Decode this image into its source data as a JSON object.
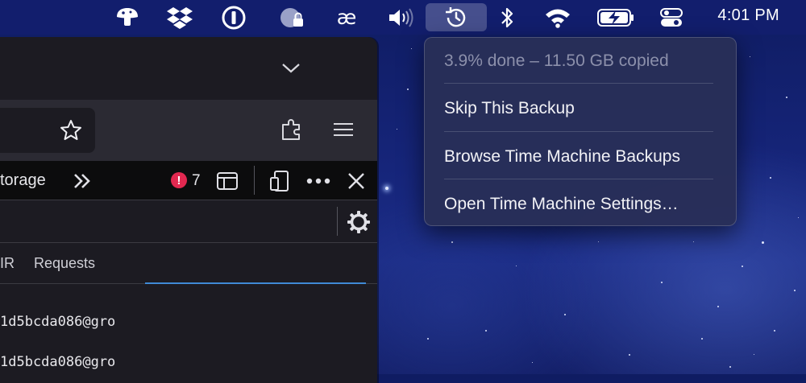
{
  "menubar": {
    "clock": "4:01 PM",
    "ae_label": "æ",
    "icons": [
      "mushroom-icon",
      "dropbox-icon",
      "onepassword-icon",
      "vpn-lock-icon",
      "ae-icon",
      "volume-icon",
      "time-machine-icon",
      "bluetooth-icon",
      "wifi-icon",
      "battery-charging-icon",
      "control-center-icon"
    ]
  },
  "time_machine_menu": {
    "status": "3.9% done – 11.50 GB copied",
    "items": [
      "Skip This Backup",
      "Browse Time Machine Backups",
      "Open Time Machine Settings…"
    ]
  },
  "browser": {
    "devtools": {
      "tab_partial": "torage",
      "error_count": "7",
      "request_tabs": [
        "IR",
        "Requests"
      ],
      "rows": [
        "1d5bcda086@gro",
        "1d5bcda086@gro"
      ]
    }
  },
  "colors": {
    "menubar_bg": "#121e6e",
    "menu_bg": "#282e58",
    "error_badge": "#e22850",
    "link_blue": "#45a1ff"
  }
}
